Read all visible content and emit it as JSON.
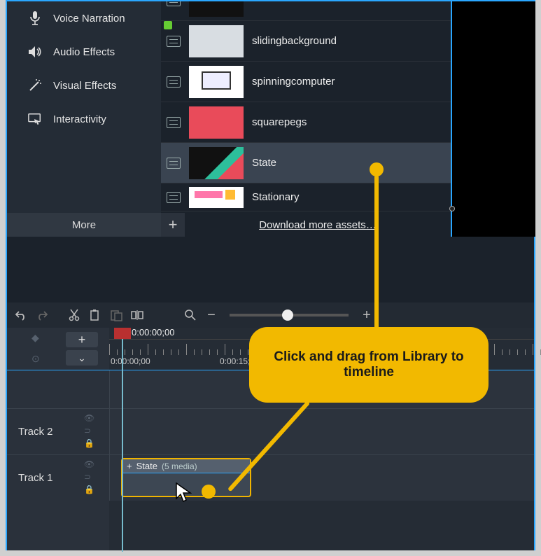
{
  "sidebar": {
    "items": [
      {
        "label": "Voice Narration",
        "icon": "mic-icon"
      },
      {
        "label": "Audio Effects",
        "icon": "speaker-icon"
      },
      {
        "label": "Visual Effects",
        "icon": "wand-icon"
      },
      {
        "label": "Interactivity",
        "icon": "interact-icon"
      }
    ],
    "more_label": "More"
  },
  "library": {
    "rows": [
      {
        "label": "",
        "thumb": "dark"
      },
      {
        "label": "slidingbackground",
        "thumb": "light"
      },
      {
        "label": "spinningcomputer",
        "thumb": "laptop"
      },
      {
        "label": "squarepegs",
        "thumb": "red"
      },
      {
        "label": "State",
        "thumb": "state",
        "selected": true
      },
      {
        "label": "Stationary",
        "thumb": "stationary"
      }
    ],
    "add_label": "+",
    "download_label": "Download more assets…"
  },
  "toolbar": {
    "undo": "undo",
    "redo": "redo",
    "cut": "cut",
    "copy": "copy",
    "paste": "paste",
    "split": "split",
    "zoom_minus": "−",
    "zoom_plus": "+"
  },
  "timeline": {
    "add_label": "+",
    "expand_label": "⌄",
    "playhead_time": "0:00:00;00",
    "ruler_labels": [
      "0:00:00;00",
      "0:00:15;00"
    ],
    "tracks": [
      {
        "name": ""
      },
      {
        "name": "Track 2"
      },
      {
        "name": "Track 1"
      }
    ],
    "clip": {
      "icon": "+",
      "name": "State",
      "meta": "(5 media)"
    }
  },
  "callout": {
    "text": "Click and drag from Library to timeline"
  }
}
